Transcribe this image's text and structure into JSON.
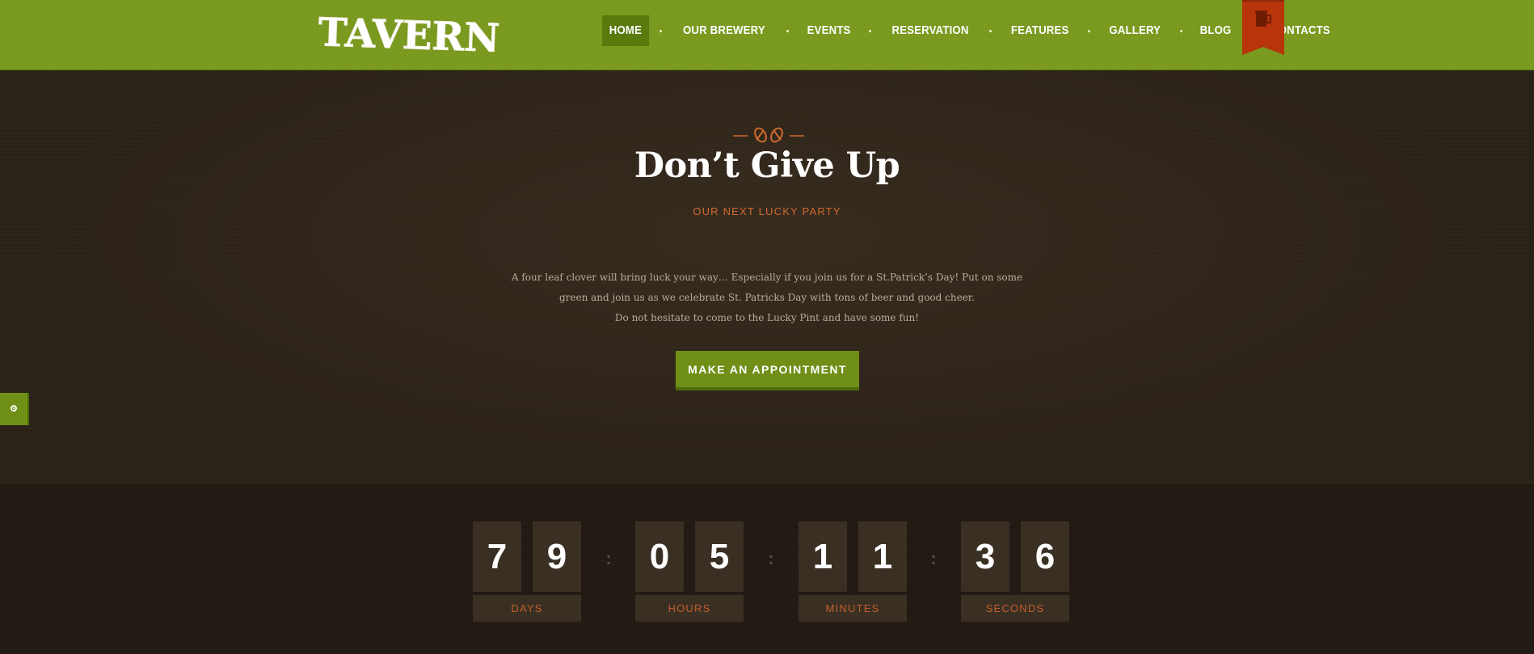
{
  "header": {
    "logo_text": "TAVERN",
    "nav": [
      {
        "label": "HOME",
        "active": true
      },
      {
        "label": "OUR BREWERY",
        "active": false
      },
      {
        "label": "EVENTS",
        "active": false
      },
      {
        "label": "RESERVATION",
        "active": false
      },
      {
        "label": "FEATURES",
        "active": false
      },
      {
        "label": "GALLERY",
        "active": false
      },
      {
        "label": "BLOG",
        "active": false
      },
      {
        "label": "CONTACTS",
        "active": false
      }
    ],
    "ribbon_icon": "beer-mug-icon"
  },
  "hero": {
    "title": "Don’t Give Up",
    "subtitle": "OUR NEXT LUCKY PARTY",
    "text_lines": [
      "A four leaf clover will bring luck your way… Especially if you join us for a St.Patrick’s Day! Put on some",
      "green and join us as we celebrate St. Patricks Day with tons of beer and good cheer.",
      "Do not hesitate to come to the Lucky Pint and have some fun!"
    ],
    "cta_label": "MAKE AN APPOINTMENT",
    "divider_icon": "hops-icon"
  },
  "side_tab": {
    "icon": "palette-icon",
    "label": "⚙"
  },
  "countdown": [
    {
      "digits": [
        "7",
        "9"
      ],
      "label": "DAYS"
    },
    {
      "digits": [
        "0",
        "5"
      ],
      "label": "HOURS"
    },
    {
      "digits": [
        "1",
        "1"
      ],
      "label": "MINUTES"
    },
    {
      "digits": [
        "3",
        "6"
      ],
      "label": "SECONDS"
    }
  ],
  "colors": {
    "header_green": "#7a9a1e",
    "accent_orange": "#d16a2f",
    "ribbon_red": "#b8340a",
    "button_green": "#6f8f17"
  }
}
